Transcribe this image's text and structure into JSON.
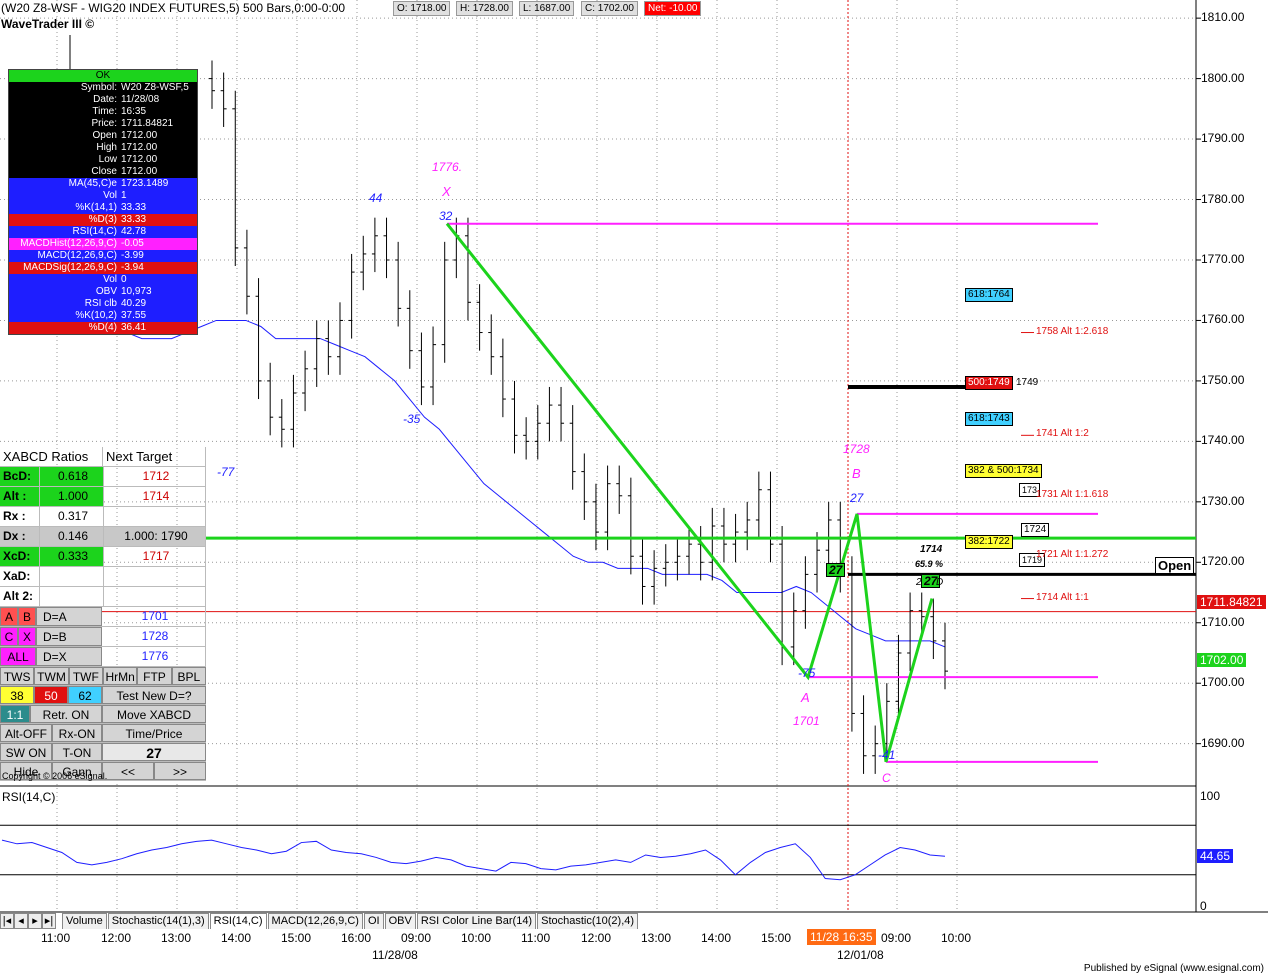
{
  "header": {
    "title": "(W20 Z8-WSF - WIG20 INDEX FUTURES,5) 500 Bars,0:00-0:00",
    "brand": "WaveTrader III ©",
    "ohlc": {
      "open": "O: 1718.00",
      "high": "H: 1728.00",
      "low": "L: 1687.00",
      "close": "C: 1702.00",
      "net": "Net: -10.00"
    }
  },
  "info_box": {
    "status": "OK",
    "rows": [
      {
        "k": "Symbol:",
        "v": "W20 Z8-WSF,5",
        "bg": "#000000"
      },
      {
        "k": "Date:",
        "v": "11/28/08",
        "bg": "#000000"
      },
      {
        "k": "Time:",
        "v": "16:35",
        "bg": "#000000"
      },
      {
        "k": "Price:",
        "v": "1711.84821",
        "bg": "#000000"
      },
      {
        "k": "Open",
        "v": "1712.00",
        "bg": "#000000"
      },
      {
        "k": "High",
        "v": "1712.00",
        "bg": "#000000"
      },
      {
        "k": "Low",
        "v": "1712.00",
        "bg": "#000000"
      },
      {
        "k": "Close",
        "v": "1712.00",
        "bg": "#000000"
      },
      {
        "k": "MA(45,C)e",
        "v": "1723.1489",
        "bg": "#1e1eff"
      },
      {
        "k": "Vol",
        "v": "1",
        "bg": "#1e1eff"
      },
      {
        "k": "%K(14,1)",
        "v": "33.33",
        "bg": "#1e1eff"
      },
      {
        "k": "%D(3)",
        "v": "33.33",
        "bg": "#e01010"
      },
      {
        "k": "RSI(14,C)",
        "v": "42.78",
        "bg": "#1e1eff"
      },
      {
        "k": "MACDHist(12,26,9,C)",
        "v": "-0.05",
        "bg": "#ff20ff"
      },
      {
        "k": "MACD(12,26,9,C)",
        "v": "-3.99",
        "bg": "#1e1eff"
      },
      {
        "k": "MACDSig(12,26,9,C)",
        "v": "-3.94",
        "bg": "#e01010"
      },
      {
        "k": "Vol",
        "v": "0",
        "bg": "#1e1eff"
      },
      {
        "k": "OBV",
        "v": "10,973",
        "bg": "#1e1eff"
      },
      {
        "k": "RSI clb",
        "v": "40.29",
        "bg": "#1e1eff"
      },
      {
        "k": "%K(10,2)",
        "v": "37.55",
        "bg": "#1e1eff"
      },
      {
        "k": "%D(4)",
        "v": "36.41",
        "bg": "#e01010"
      }
    ]
  },
  "xabcd": {
    "header_left": "XABCD Ratios",
    "header_right": "Next Target",
    "rows": [
      {
        "l": "BcD:",
        "v": "0.618",
        "t": "1712",
        "lbg": "#1cd31c",
        "tcolor": "#cc0000"
      },
      {
        "l": "Alt  :",
        "v": "1.000",
        "t": "1714",
        "lbg": "#1cd31c",
        "tcolor": "#cc0000"
      },
      {
        "l": "Rx  :",
        "v": "0.317",
        "t": "",
        "lbg": "#ffffff",
        "tcolor": "#000"
      },
      {
        "l": "Dx  :",
        "v": "0.146",
        "t": "1.000: 1790",
        "lbg": "#c8c8c8",
        "tcolor": "#000"
      },
      {
        "l": "XcD:",
        "v": "0.333",
        "t": "1717",
        "lbg": "#1cd31c",
        "tcolor": "#cc0000"
      },
      {
        "l": "XaD:",
        "v": "",
        "t": "",
        "lbg": "#ffffff",
        "tcolor": "#000"
      },
      {
        "l": "Alt 2:",
        "v": "",
        "t": "",
        "lbg": "#ffffff",
        "tcolor": "#000"
      }
    ],
    "links": [
      {
        "a": "A",
        "b": "B",
        "eq": "D=A",
        "val": "1701"
      },
      {
        "a": "C",
        "b": "X",
        "eq": "D=B",
        "val": "1728"
      },
      {
        "a": "ALL",
        "b": "",
        "eq": "D=X",
        "val": "1776"
      }
    ],
    "buttons_row1": [
      "TWS",
      "TWM",
      "TWF",
      "HrMn",
      "FTP",
      "BPL"
    ],
    "numbers": {
      "a": "38",
      "b": "50",
      "c": "62",
      "test": "Test New D=?"
    },
    "r1": "1:1",
    "retr": "Retr. ON",
    "move": "Move XABCD",
    "altoff": "Alt-OFF",
    "rxon": "Rx-ON",
    "timeprice": "Time/Price",
    "swon": "SW ON",
    "ton": "T-ON",
    "count": "27",
    "hide": "Hide",
    "gann": "Gann",
    "prev": "<<",
    "next": ">>"
  },
  "copyright": "Copyright © 2006 eSignal.",
  "rsi_title": "RSI(14,C)",
  "rsi_axis": [
    "100",
    "50",
    "0"
  ],
  "rsi_value": "44.65",
  "tabs": [
    "Volume",
    "Stochastic(14(1),3)",
    "RSI(14,C)",
    "MACD(12,26,9,C)",
    "OI",
    "OBV",
    "RSI Color Line Bar(14)",
    "Stochastic(10(2),4)"
  ],
  "time_axis": [
    "11:00",
    "12:00",
    "13:00",
    "14:00",
    "15:00",
    "16:00",
    "09:00",
    "10:00",
    "11:00",
    "12:00",
    "13:00",
    "14:00",
    "15:00",
    "09:00",
    "10:00"
  ],
  "cursor_time": "11/28 16:35",
  "dates": [
    "11/28/08",
    "12/01/08"
  ],
  "published": "Published by eSignal (www.esignal.com)",
  "price_axis": [
    "1810.00",
    "1800.00",
    "1790.00",
    "1780.00",
    "1770.00",
    "1760.00",
    "1750.00",
    "1740.00",
    "1730.00",
    "1720.00",
    "1710.00",
    "1700.00",
    "1690.00"
  ],
  "price_badges": {
    "current": "1711.84821",
    "close": "1702.00"
  },
  "pattern_labels": {
    "x_price": "1776.",
    "x": "X",
    "x_count": "32",
    "peak": "44",
    "trough1": "-35",
    "trough2": "-77",
    "b_price": "1728",
    "b": "B",
    "b_count": "27",
    "a": "A",
    "a_price": "1701",
    "a_count": "-75",
    "c": "C",
    "c_count": "-41",
    "d": "D",
    "d_count": "27",
    "d_count2": "27",
    "d_pct": "65.9 %",
    "d_price": "1714",
    "d_num": "2"
  },
  "targets": [
    {
      "label": "618:1764",
      "bg": "#40d0ff"
    },
    {
      "label": "500:1749",
      "bg": "#e01010"
    },
    {
      "label": "618:1743",
      "bg": "#40d0ff"
    },
    {
      "label": "382 & 500:1734",
      "bg": "#ffff33"
    },
    {
      "label": "382:1722",
      "bg": "#ffff33"
    }
  ],
  "alt_targets": [
    "1758 Alt 1:2.618",
    "1741 Alt 1:2",
    "1731 Alt 1:1.618",
    "1721 Alt 1:1.272",
    "1714 Alt 1:1"
  ],
  "line_tags": {
    "t1749": "1749",
    "t173": "173",
    "t1724": "1724",
    "t1719": "1719",
    "open": "Open"
  },
  "chart_data": {
    "type": "line",
    "ylim": [
      1683,
      1813
    ],
    "xabcd_points": [
      {
        "name": "X",
        "y": 1776
      },
      {
        "name": "A",
        "y": 1701
      },
      {
        "name": "B",
        "y": 1728
      },
      {
        "name": "C",
        "y": 1687
      },
      {
        "name": "D",
        "y": 1714
      }
    ],
    "horizontal_levels": {
      "magenta": [
        1776,
        1728,
        1701,
        1687
      ],
      "green": 1724,
      "black": [
        1749,
        1718
      ],
      "red": 1711.85
    },
    "close_series": [
      1798,
      1795,
      1772,
      1764,
      1750,
      1744,
      1742,
      1748,
      1752,
      1757,
      1754,
      1760,
      1768,
      1771,
      1774,
      1770,
      1762,
      1755,
      1749,
      1756,
      1770,
      1774,
      1763,
      1758,
      1754,
      1747,
      1741,
      1740,
      1743,
      1746,
      1743,
      1735,
      1730,
      1725,
      1733,
      1731,
      1721,
      1716,
      1719,
      1720,
      1721,
      1723,
      1720,
      1726,
      1723,
      1725,
      1727,
      1732,
      1723,
      1706,
      1712,
      1718,
      1722,
      1727,
      1718,
      1695,
      1688,
      1690,
      1697,
      1705,
      1712,
      1711,
      1707,
      1702
    ],
    "ma_series": [
      1780,
      1778,
      1774,
      1770,
      1766,
      1763,
      1761,
      1759,
      1758,
      1757,
      1757,
      1757,
      1758,
      1759,
      1760,
      1760,
      1760,
      1759,
      1757,
      1757,
      1757,
      1757,
      1756,
      1755,
      1754,
      1752,
      1750,
      1747,
      1744,
      1742,
      1739,
      1736,
      1733,
      1731,
      1729,
      1727,
      1725,
      1723,
      1721,
      1720,
      1720,
      1719,
      1719,
      1719,
      1718,
      1718,
      1718,
      1718,
      1717,
      1715,
      1715,
      1715,
      1715,
      1716,
      1715,
      1713,
      1711,
      1709,
      1708,
      1707,
      1707,
      1707,
      1707,
      1706
    ],
    "rsi_series": [
      58,
      55,
      56,
      52,
      48,
      40,
      38,
      40,
      43,
      47,
      50,
      52,
      55,
      57,
      58,
      55,
      52,
      50,
      47,
      49,
      56,
      57,
      50,
      48,
      47,
      44,
      40,
      39,
      41,
      44,
      42,
      37,
      35,
      33,
      40,
      39,
      35,
      34,
      37,
      38,
      40,
      42,
      40,
      46,
      44,
      45,
      47,
      50,
      42,
      30,
      40,
      48,
      52,
      55,
      44,
      27,
      26,
      30,
      38,
      46,
      52,
      50,
      46,
      45
    ]
  }
}
